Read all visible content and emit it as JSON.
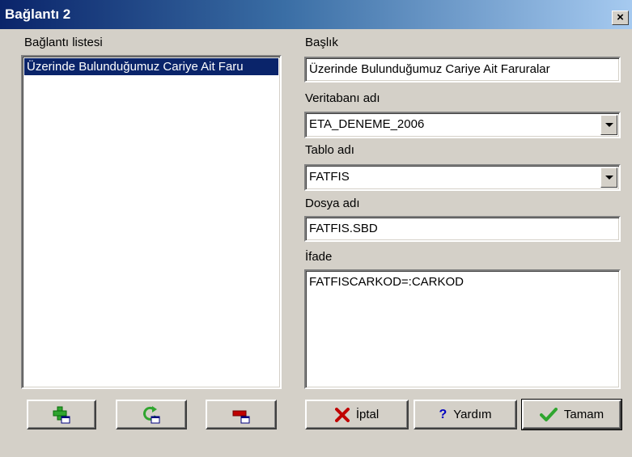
{
  "window": {
    "title": "Bağlantı 2",
    "close_glyph": "×"
  },
  "left_panel": {
    "label": "Bağlantı listesi",
    "items": [
      {
        "label": "Üzerinde Bulunduğumuz Cariye Ait Faru"
      }
    ]
  },
  "form": {
    "title_label": "Başlık",
    "title_value": "Üzerinde Bulunduğumuz Cariye Ait Faruralar",
    "db_label": "Veritabanı adı",
    "db_value": "ETA_DENEME_2006",
    "table_label": "Tablo adı",
    "table_value": "FATFIS",
    "file_label": "Dosya adı",
    "file_value": "FATFIS.SBD",
    "expr_label": "İfade",
    "expr_value": "FATFISCARKOD=:CARKOD"
  },
  "buttons": {
    "add_icon": "add-icon",
    "refresh_icon": "refresh-icon",
    "delete_icon": "delete-icon",
    "cancel_label": "İptal",
    "help_label": "Yardım",
    "ok_label": "Tamam"
  },
  "colors": {
    "selection": "#0a246a",
    "face": "#d4d0c8",
    "add_green": "#2fa52f",
    "delete_red": "#c00000"
  }
}
